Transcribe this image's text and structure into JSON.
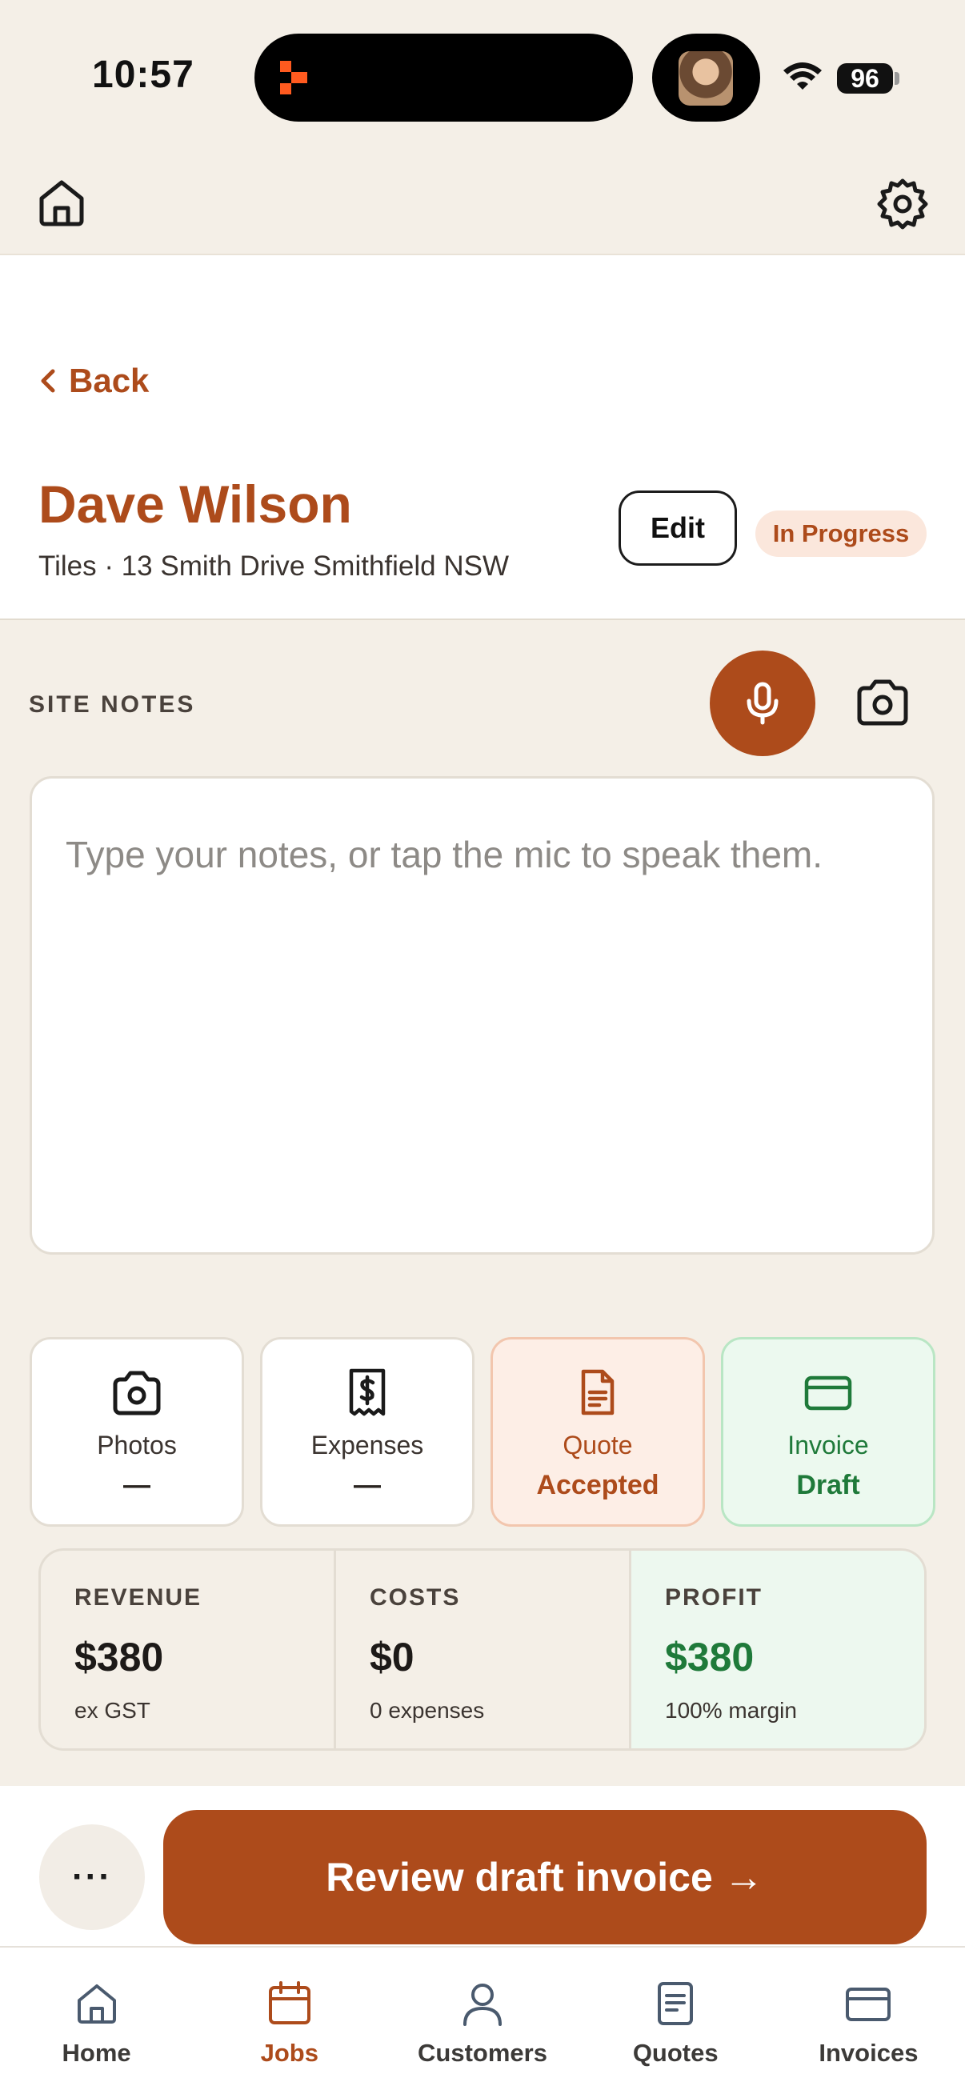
{
  "status_bar": {
    "time": "10:57",
    "battery": "96"
  },
  "colors": {
    "accent": "#ad4b1b",
    "success": "#1f7a3a",
    "background": "#f4efe7"
  },
  "header": {
    "back_label": "Back",
    "customer_name": "Dave Wilson",
    "subtitle": "Tiles · 13 Smith Drive Smithfield NSW",
    "edit_label": "Edit",
    "status": "In Progress"
  },
  "site_notes": {
    "label": "SITE NOTES",
    "placeholder": "Type your notes, or tap the mic to speak them."
  },
  "tiles": [
    {
      "icon": "camera-icon",
      "label": "Photos",
      "value": "—"
    },
    {
      "icon": "receipt-icon",
      "label": "Expenses",
      "value": "—"
    },
    {
      "icon": "document-icon",
      "label": "Quote",
      "value": "Accepted"
    },
    {
      "icon": "card-icon",
      "label": "Invoice",
      "value": "Draft"
    }
  ],
  "financials": [
    {
      "label": "REVENUE",
      "value": "$380",
      "sub": "ex GST"
    },
    {
      "label": "COSTS",
      "value": "$0",
      "sub": "0 expenses"
    },
    {
      "label": "PROFIT",
      "value": "$380",
      "sub": "100% margin"
    }
  ],
  "actions": {
    "more_label": "···",
    "primary_label": "Review draft invoice →"
  },
  "tabbar": [
    {
      "icon": "home-icon",
      "label": "Home"
    },
    {
      "icon": "calendar-icon",
      "label": "Jobs"
    },
    {
      "icon": "person-icon",
      "label": "Customers"
    },
    {
      "icon": "quote-doc-icon",
      "label": "Quotes"
    },
    {
      "icon": "card-icon",
      "label": "Invoices"
    }
  ]
}
